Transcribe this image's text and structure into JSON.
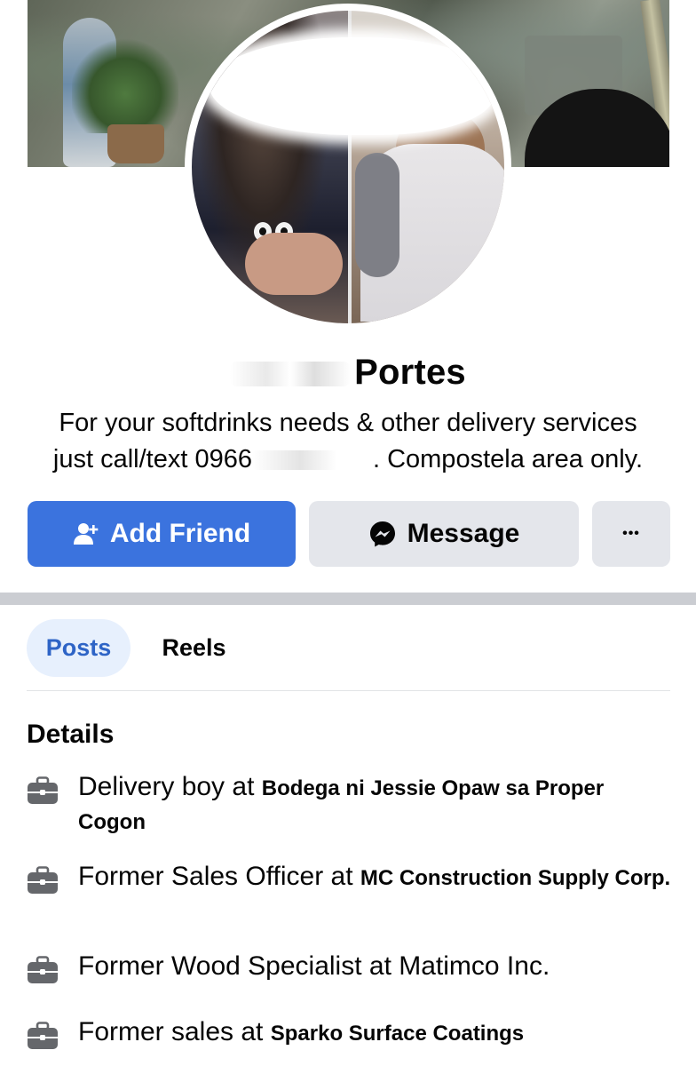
{
  "profile": {
    "name_visible": "Portes",
    "bio_line1": "For your softdrinks needs & other delivery services",
    "bio_line2_prefix": "just call/text 0966",
    "bio_line2_suffix": ". Compostela area only."
  },
  "actions": {
    "add_friend": "Add Friend",
    "message": "Message",
    "more": "•••"
  },
  "tabs": {
    "posts": "Posts",
    "reels": "Reels"
  },
  "details": {
    "title": "Details",
    "items": [
      {
        "role": "Delivery boy at ",
        "place": "Bodega ni Jessie Opaw sa Proper Cogon"
      },
      {
        "role": "Former Sales Officer at ",
        "place": "MC Construction Supply Corp."
      },
      {
        "role": "Former Wood Specialist at Matimco Inc.",
        "place": ""
      },
      {
        "role": "Former sales at ",
        "place": "Sparko Surface Coatings"
      }
    ]
  },
  "colors": {
    "primary_blue": "#3b73de",
    "secondary_gray": "#e4e6eb",
    "tab_active_bg": "#e7f0fd",
    "tab_active_text": "#2e64c6"
  },
  "icons": {
    "add_friend": "person-plus-icon",
    "message": "messenger-icon",
    "detail": "briefcase-icon"
  }
}
